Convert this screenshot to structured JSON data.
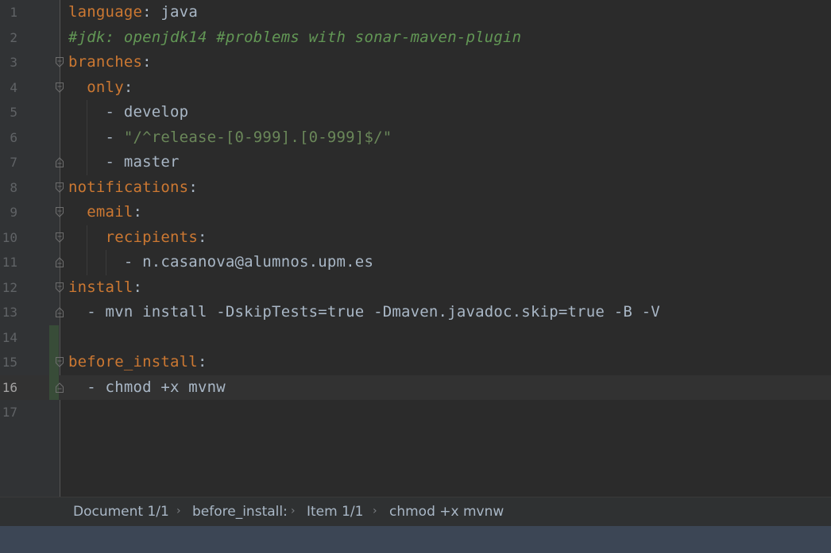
{
  "editor": {
    "lines": [
      {
        "number": "1",
        "segments": [
          {
            "t": "language",
            "c": "key"
          },
          {
            "t": ": java",
            "c": ""
          }
        ]
      },
      {
        "number": "2",
        "segments": [
          {
            "t": "#jdk: openjdk14 #problems with sonar-maven-plugin",
            "c": "comment"
          }
        ]
      },
      {
        "number": "3",
        "segments": [
          {
            "t": "branches",
            "c": "key"
          },
          {
            "t": ":",
            "c": ""
          }
        ],
        "fold": "open"
      },
      {
        "number": "4",
        "segments": [
          {
            "t": "  ",
            "c": ""
          },
          {
            "t": "only",
            "c": "key"
          },
          {
            "t": ":",
            "c": ""
          }
        ],
        "fold": "open"
      },
      {
        "number": "5",
        "segments": [
          {
            "t": "    - develop",
            "c": ""
          }
        ]
      },
      {
        "number": "6",
        "segments": [
          {
            "t": "    - ",
            "c": ""
          },
          {
            "t": "\"/^release-[0-999].[0-999]$/\"",
            "c": "str"
          }
        ]
      },
      {
        "number": "7",
        "segments": [
          {
            "t": "    - master",
            "c": ""
          }
        ],
        "fold": "end"
      },
      {
        "number": "8",
        "segments": [
          {
            "t": "notifications",
            "c": "key"
          },
          {
            "t": ":",
            "c": ""
          }
        ],
        "fold": "open"
      },
      {
        "number": "9",
        "segments": [
          {
            "t": "  ",
            "c": ""
          },
          {
            "t": "email",
            "c": "key"
          },
          {
            "t": ":",
            "c": ""
          }
        ],
        "fold": "open"
      },
      {
        "number": "10",
        "segments": [
          {
            "t": "    ",
            "c": ""
          },
          {
            "t": "recipients",
            "c": "key"
          },
          {
            "t": ":",
            "c": ""
          }
        ],
        "fold": "open"
      },
      {
        "number": "11",
        "segments": [
          {
            "t": "      - n.casanova@alumnos.upm.es",
            "c": ""
          }
        ],
        "fold": "end"
      },
      {
        "number": "12",
        "segments": [
          {
            "t": "install",
            "c": "key"
          },
          {
            "t": ":",
            "c": ""
          }
        ],
        "fold": "open"
      },
      {
        "number": "13",
        "segments": [
          {
            "t": "  - mvn install -DskipTests=true -Dmaven.javadoc.skip=true -B -V",
            "c": ""
          }
        ],
        "fold": "end"
      },
      {
        "number": "14",
        "segments": [],
        "vcs": true
      },
      {
        "number": "15",
        "segments": [
          {
            "t": "before_install",
            "c": "key"
          },
          {
            "t": ":",
            "c": ""
          }
        ],
        "fold": "open",
        "vcs": true
      },
      {
        "number": "16",
        "segments": [
          {
            "t": "  - chmod +x mvnw",
            "c": ""
          }
        ],
        "fold": "end",
        "vcs": true,
        "current": true
      },
      {
        "number": "17",
        "segments": []
      }
    ]
  },
  "breadcrumbs": {
    "items": [
      "Document 1/1",
      "before_install:",
      "Item 1/1",
      "chmod +x mvnw"
    ],
    "separator": "›"
  },
  "colors": {
    "background": "#2b2b2b",
    "key": "#cc7832",
    "comment": "#629755",
    "string": "#6a8759",
    "text": "#a9b7c6",
    "status_bar": "#3c4655"
  }
}
